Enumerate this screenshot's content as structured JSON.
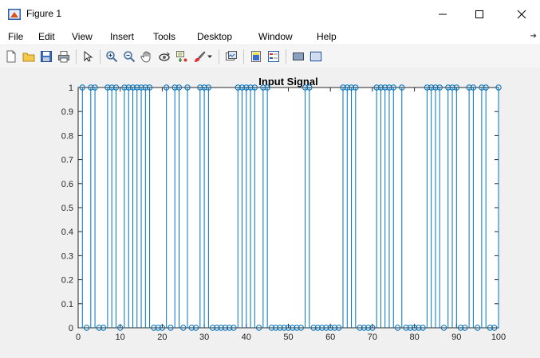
{
  "window": {
    "title": "Figure 1",
    "controls": {
      "minimize": "minimize-icon",
      "maximize": "maximize-icon",
      "close": "close-icon"
    }
  },
  "menu": {
    "items": [
      {
        "label": "File"
      },
      {
        "label": "Edit"
      },
      {
        "label": "View"
      },
      {
        "label": "Insert"
      },
      {
        "label": "Tools"
      },
      {
        "label": "Desktop"
      },
      {
        "label": "Window"
      },
      {
        "label": "Help"
      }
    ]
  },
  "toolbar": {
    "icons": [
      "new-figure-icon",
      "open-file-icon",
      "save-icon",
      "print-icon",
      "pointer-icon",
      "zoom-in-icon",
      "zoom-out-icon",
      "pan-icon",
      "rotate-3d-icon",
      "data-cursor-icon",
      "brush-icon",
      "brush-dropdown-icon",
      "link-plot-icon",
      "colorbar-icon",
      "legend-icon",
      "hide-plot-tools-icon",
      "show-plot-tools-icon"
    ]
  },
  "colors": {
    "stem": "#0072BD",
    "figure_bg": "#f0f0f0",
    "axes_bg": "#ffffff"
  },
  "chart_data": {
    "type": "stem",
    "title": "Input Signal",
    "xlabel": "",
    "ylabel": "",
    "xlim": [
      0,
      100
    ],
    "ylim": [
      0,
      1
    ],
    "xticks": [
      0,
      10,
      20,
      30,
      40,
      50,
      60,
      70,
      80,
      90,
      100
    ],
    "yticks": [
      0,
      0.1,
      0.2,
      0.3,
      0.4,
      0.5,
      0.6,
      0.7,
      0.8,
      0.9,
      1
    ],
    "grid": false,
    "x": [
      1,
      2,
      3,
      4,
      5,
      6,
      7,
      8,
      9,
      10,
      11,
      12,
      13,
      14,
      15,
      16,
      17,
      18,
      19,
      20,
      21,
      22,
      23,
      24,
      25,
      26,
      27,
      28,
      29,
      30,
      31,
      32,
      33,
      34,
      35,
      36,
      37,
      38,
      39,
      40,
      41,
      42,
      43,
      44,
      45,
      46,
      47,
      48,
      49,
      50,
      51,
      52,
      53,
      54,
      55,
      56,
      57,
      58,
      59,
      60,
      61,
      62,
      63,
      64,
      65,
      66,
      67,
      68,
      69,
      70,
      71,
      72,
      73,
      74,
      75,
      76,
      77,
      78,
      79,
      80,
      81,
      82,
      83,
      84,
      85,
      86,
      87,
      88,
      89,
      90,
      91,
      92,
      93,
      94,
      95,
      96,
      97,
      98,
      99,
      100
    ],
    "values": [
      1,
      0,
      1,
      1,
      0,
      0,
      1,
      1,
      1,
      0,
      1,
      1,
      1,
      1,
      1,
      1,
      1,
      0,
      0,
      0,
      1,
      0,
      1,
      1,
      0,
      1,
      0,
      0,
      1,
      1,
      1,
      0,
      0,
      0,
      0,
      0,
      0,
      1,
      1,
      1,
      1,
      1,
      0,
      1,
      1,
      0,
      0,
      0,
      0,
      0,
      0,
      0,
      0,
      1,
      1,
      0,
      0,
      0,
      0,
      0,
      0,
      0,
      1,
      1,
      1,
      1,
      0,
      0,
      0,
      0,
      1,
      1,
      1,
      1,
      1,
      0,
      1,
      0,
      0,
      0,
      0,
      0,
      1,
      1,
      1,
      1,
      0,
      1,
      1,
      1,
      0,
      0,
      1,
      1,
      0,
      1,
      1,
      0,
      0,
      1
    ]
  }
}
